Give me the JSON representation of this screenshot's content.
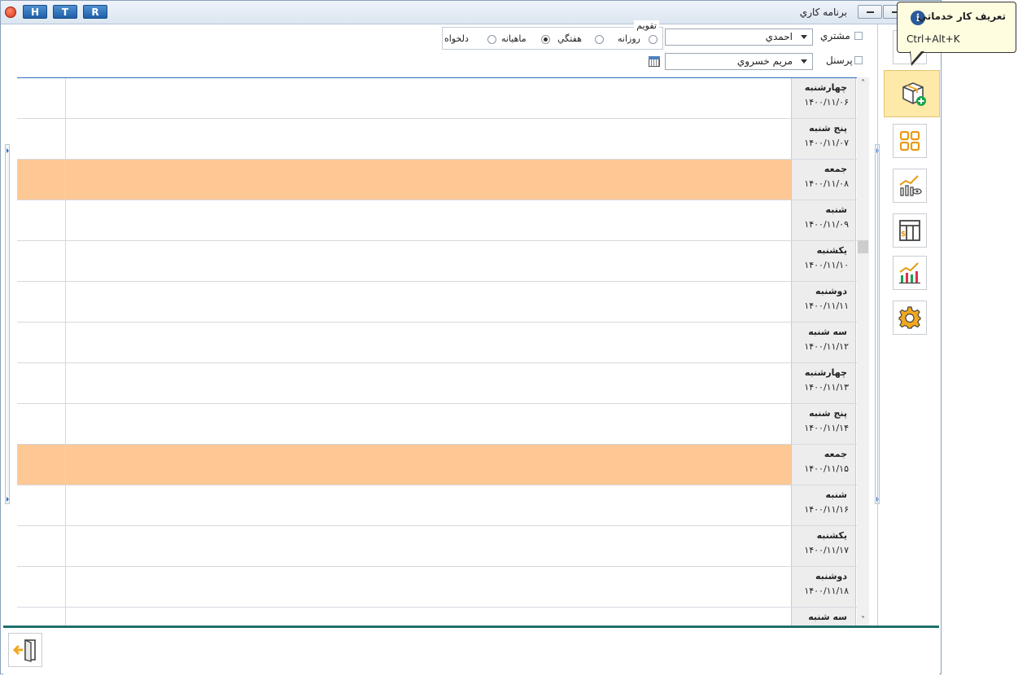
{
  "titlebar": {
    "title": "برنامه كاري",
    "shortcuts": [
      "H",
      "T",
      "R"
    ]
  },
  "filters": {
    "customer_label": "مشتري",
    "customer_value": "احمدي",
    "staff_label": "پرسنل",
    "staff_value": "مريم خسروي",
    "calendar_title": "تقويم",
    "view_daily": "روزانه",
    "view_weekly": "هفتگي",
    "view_monthly": "ماهيانه",
    "view_custom": "دلخواه",
    "selected_view": "هفتگي"
  },
  "schedule": {
    "rows": [
      {
        "day": "چهارشنبه",
        "date": "۱۴۰۰/۱۱/۰۶",
        "holiday": false
      },
      {
        "day": "پنج شنبه",
        "date": "۱۴۰۰/۱۱/۰۷",
        "holiday": false
      },
      {
        "day": "جمعه",
        "date": "۱۴۰۰/۱۱/۰۸",
        "holiday": true
      },
      {
        "day": "شنبه",
        "date": "۱۴۰۰/۱۱/۰۹",
        "holiday": false
      },
      {
        "day": "يكشنبه",
        "date": "۱۴۰۰/۱۱/۱۰",
        "holiday": false
      },
      {
        "day": "دوشنبه",
        "date": "۱۴۰۰/۱۱/۱۱",
        "holiday": false
      },
      {
        "day": "سه شنبه",
        "date": "۱۴۰۰/۱۱/۱۲",
        "holiday": false
      },
      {
        "day": "چهارشنبه",
        "date": "۱۴۰۰/۱۱/۱۳",
        "holiday": false
      },
      {
        "day": "پنج شنبه",
        "date": "۱۴۰۰/۱۱/۱۴",
        "holiday": false
      },
      {
        "day": "جمعه",
        "date": "۱۴۰۰/۱۱/۱۵",
        "holiday": true
      },
      {
        "day": "شنبه",
        "date": "۱۴۰۰/۱۱/۱۶",
        "holiday": false
      },
      {
        "day": "يكشنبه",
        "date": "۱۴۰۰/۱۱/۱۷",
        "holiday": false
      },
      {
        "day": "دوشنبه",
        "date": "۱۴۰۰/۱۱/۱۸",
        "holiday": false
      },
      {
        "day": "سه شنبه",
        "date": "",
        "holiday": false
      }
    ],
    "holiday_color": "#fec894"
  },
  "tooltip": {
    "title": "تعريف كار خدماتي",
    "shortcut": "Ctrl+Alt+K"
  },
  "sidebar": {
    "buttons": [
      {
        "name": "define-service-job",
        "icon": "package-add-icon",
        "active": true
      },
      {
        "name": "dashboard",
        "icon": "grid-icon",
        "active": false
      },
      {
        "name": "report-view",
        "icon": "chart-eye-icon",
        "active": false
      },
      {
        "name": "price-table",
        "icon": "table-dollar-icon",
        "active": false
      },
      {
        "name": "statistics",
        "icon": "bar-chart-icon",
        "active": false
      },
      {
        "name": "settings",
        "icon": "gear-icon",
        "active": false
      }
    ]
  },
  "colors": {
    "accent": "#2d6bbd",
    "active_button": "#fde9a8",
    "bottom_border": "#1f6f6a"
  }
}
